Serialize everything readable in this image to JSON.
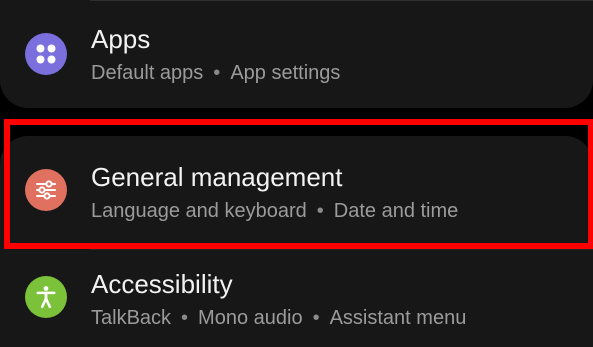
{
  "settings": {
    "items": [
      {
        "title": "Apps",
        "subtitle_parts": [
          "Default apps",
          "App settings"
        ],
        "icon": "apps-grid-icon",
        "icon_color": "#7a6fdc"
      },
      {
        "title": "General management",
        "subtitle_parts": [
          "Language and keyboard",
          "Date and time"
        ],
        "icon": "sliders-icon",
        "icon_color": "#e0705f"
      },
      {
        "title": "Accessibility",
        "subtitle_parts": [
          "TalkBack",
          "Mono audio",
          "Assistant menu"
        ],
        "icon": "accessibility-person-icon",
        "icon_color": "#7cc13a"
      }
    ]
  },
  "highlight": {
    "color": "#ff0000",
    "target": "General management"
  },
  "separator": "•"
}
